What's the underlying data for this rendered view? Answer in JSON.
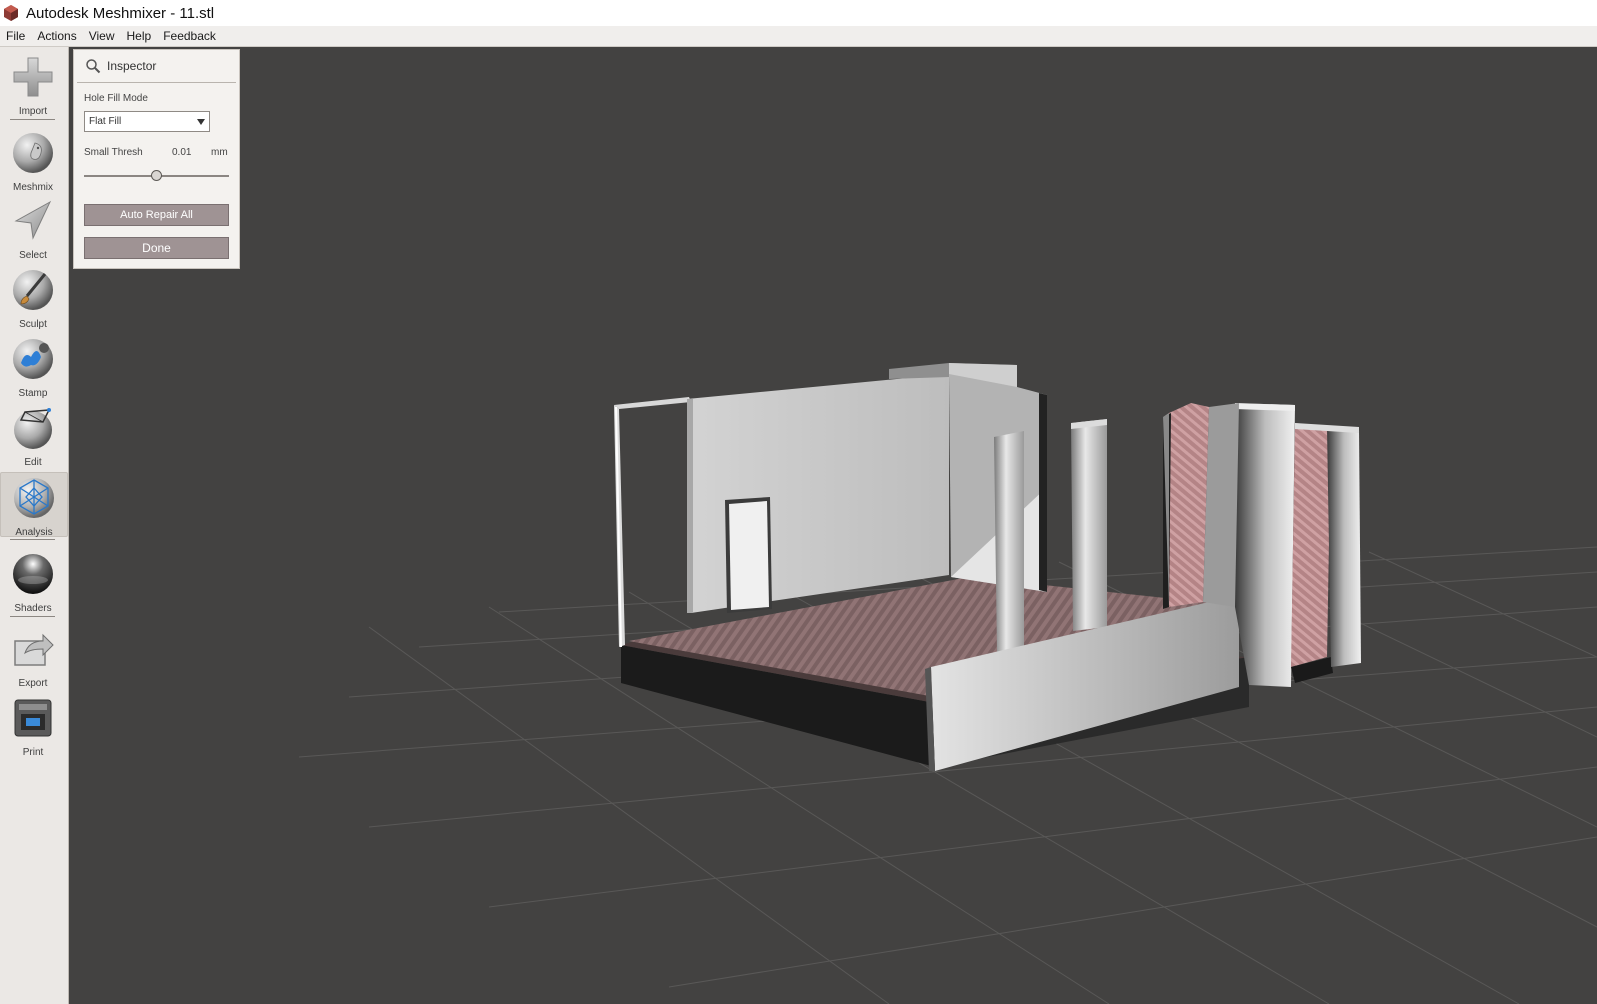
{
  "window": {
    "title": "Autodesk Meshmixer - 11.stl"
  },
  "menu": [
    "File",
    "Actions",
    "View",
    "Help",
    "Feedback"
  ],
  "tools": [
    {
      "label": "Import",
      "icon": "import-plus-icon"
    },
    {
      "label": "Meshmix",
      "icon": "meshmix-bunny-sphere-icon"
    },
    {
      "label": "Select",
      "icon": "select-arrow-icon"
    },
    {
      "label": "Sculpt",
      "icon": "sculpt-brush-sphere-icon"
    },
    {
      "label": "Stamp",
      "icon": "stamp-sphere-icon"
    },
    {
      "label": "Edit",
      "icon": "edit-sphere-icon"
    },
    {
      "label": "Analysis",
      "icon": "analysis-mesh-sphere-icon",
      "active": true
    },
    {
      "label": "Shaders",
      "icon": "shaders-sphere-icon"
    },
    {
      "label": "Export",
      "icon": "export-icon"
    },
    {
      "label": "Print",
      "icon": "print-icon"
    }
  ],
  "inspector": {
    "title": "Inspector",
    "icon": "search-icon",
    "hole_fill_mode_label": "Hole Fill Mode",
    "hole_fill_mode_value": "Flat Fill",
    "small_thresh_label": "Small Thresh",
    "small_thresh_value": "0.01",
    "small_thresh_unit": "mm",
    "small_thresh_slider_fraction": 0.5,
    "auto_repair_label": "Auto Repair All",
    "done_label": "Done"
  },
  "colors": {
    "viewport_bg": "#434241",
    "button_bg": "#9f9394",
    "mesh_gray": "#c8c8c8",
    "mesh_floor": "#8a6a6a"
  }
}
